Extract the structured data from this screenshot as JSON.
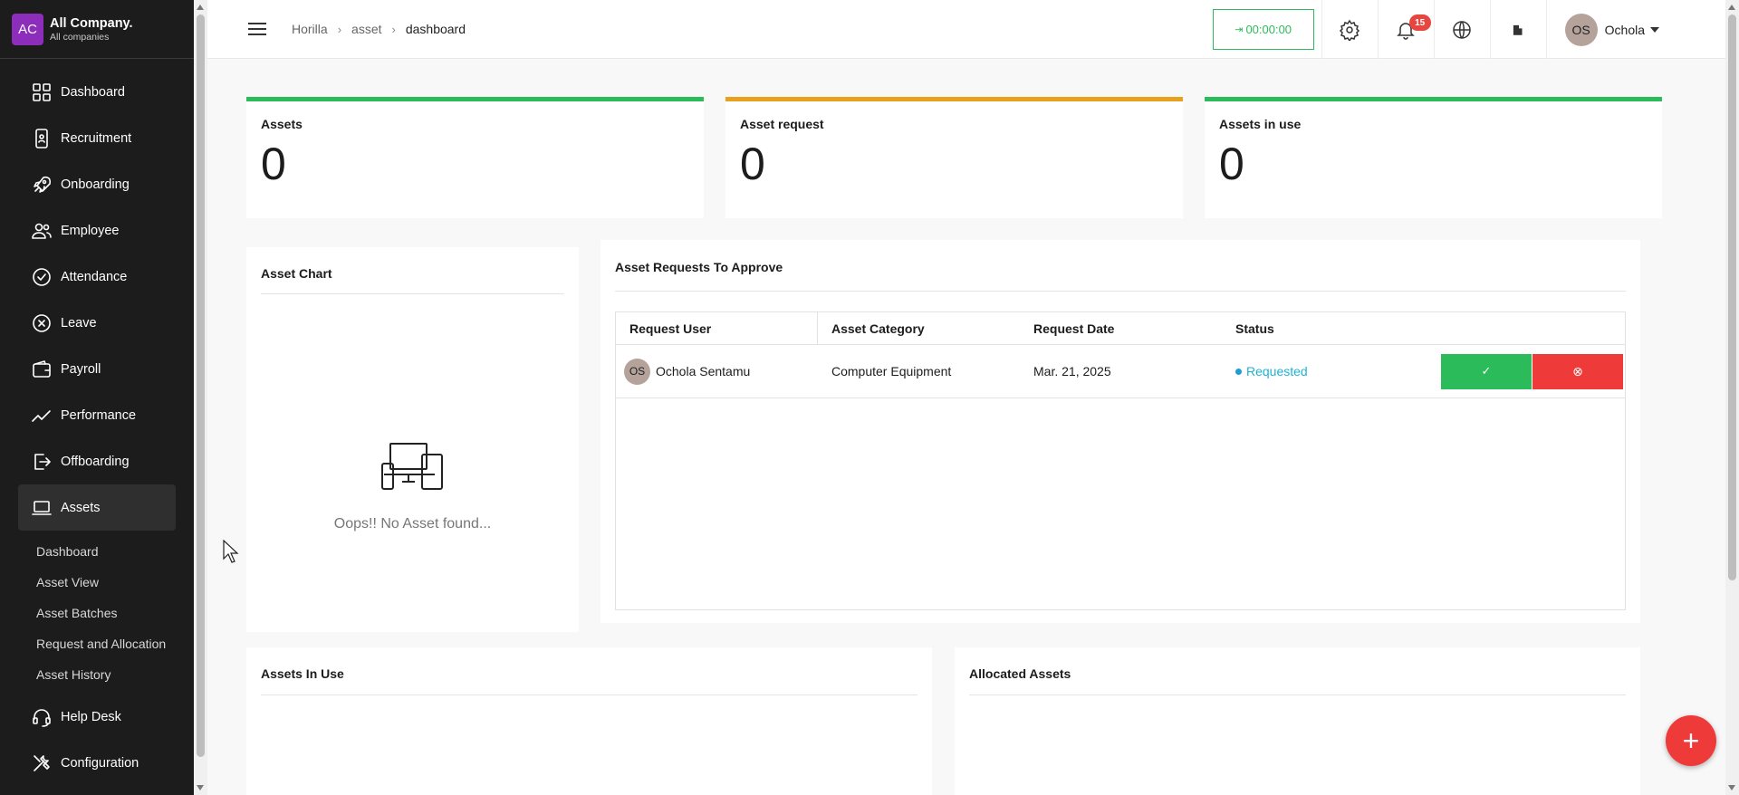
{
  "company": {
    "initials": "AC",
    "name": "All Company.",
    "subtitle": "All companies"
  },
  "sidebar": {
    "items": [
      {
        "label": "Dashboard",
        "icon": "dashboard-icon"
      },
      {
        "label": "Recruitment",
        "icon": "recruitment-icon"
      },
      {
        "label": "Onboarding",
        "icon": "rocket-icon"
      },
      {
        "label": "Employee",
        "icon": "people-icon"
      },
      {
        "label": "Attendance",
        "icon": "check-circle-icon"
      },
      {
        "label": "Leave",
        "icon": "x-circle-icon"
      },
      {
        "label": "Payroll",
        "icon": "wallet-icon"
      },
      {
        "label": "Performance",
        "icon": "trend-icon"
      },
      {
        "label": "Offboarding",
        "icon": "exit-icon"
      },
      {
        "label": "Assets",
        "icon": "laptop-icon"
      },
      {
        "label": "Help Desk",
        "icon": "headset-icon"
      },
      {
        "label": "Configuration",
        "icon": "tools-icon"
      }
    ],
    "assets_sub": [
      "Dashboard",
      "Asset View",
      "Asset Batches",
      "Request and Allocation",
      "Asset History"
    ]
  },
  "header": {
    "breadcrumb": [
      "Horilla",
      "asset",
      "dashboard"
    ],
    "timer": "00:00:00",
    "notification_count": "15",
    "user_initials": "OS",
    "user_name": "Ochola"
  },
  "stats": [
    {
      "title": "Assets",
      "value": "0",
      "color": "#2cbb5a"
    },
    {
      "title": "Asset request",
      "value": "0",
      "color": "#e8a11f"
    },
    {
      "title": "Assets in use",
      "value": "0",
      "color": "#2cbb5a"
    }
  ],
  "asset_chart": {
    "title": "Asset Chart",
    "empty_text": "Oops!! No Asset found..."
  },
  "requests": {
    "title": "Asset Requests To Approve",
    "columns": [
      "Request User",
      "Asset Category",
      "Request Date",
      "Status"
    ],
    "rows": [
      {
        "initials": "OS",
        "user": "Ochola Sentamu",
        "category": "Computer Equipment",
        "date": "Mar. 21, 2025",
        "status": "Requested"
      }
    ],
    "approve_icon": "✓",
    "reject_icon": "⊗"
  },
  "bottom": {
    "in_use_title": "Assets In Use",
    "allocated_title": "Allocated Assets"
  },
  "fab": "+"
}
